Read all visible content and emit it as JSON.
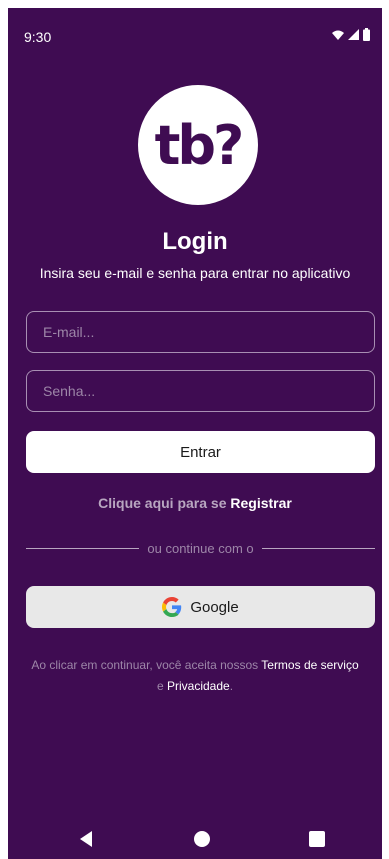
{
  "status": {
    "time": "9:30"
  },
  "logo": {
    "text": "tb?"
  },
  "login": {
    "title": "Login",
    "subtitle": "Insira seu e-mail e senha para entrar no aplicativo",
    "email_placeholder": "E-mail...",
    "password_placeholder": "Senha...",
    "submit_label": "Entrar"
  },
  "register": {
    "prefix": "Clique aqui para se ",
    "link": "Registrar"
  },
  "divider": {
    "text": "ou continue com o"
  },
  "google": {
    "label": "Google"
  },
  "terms": {
    "prefix": "Ao clicar em continuar, você aceita nossos ",
    "terms_link": "Termos de serviço",
    "connector": " e ",
    "privacy_link": "Privacidade",
    "suffix": "."
  },
  "colors": {
    "background": "#3f0c52",
    "text": "#ffffff",
    "muted": "#9d86a8"
  }
}
